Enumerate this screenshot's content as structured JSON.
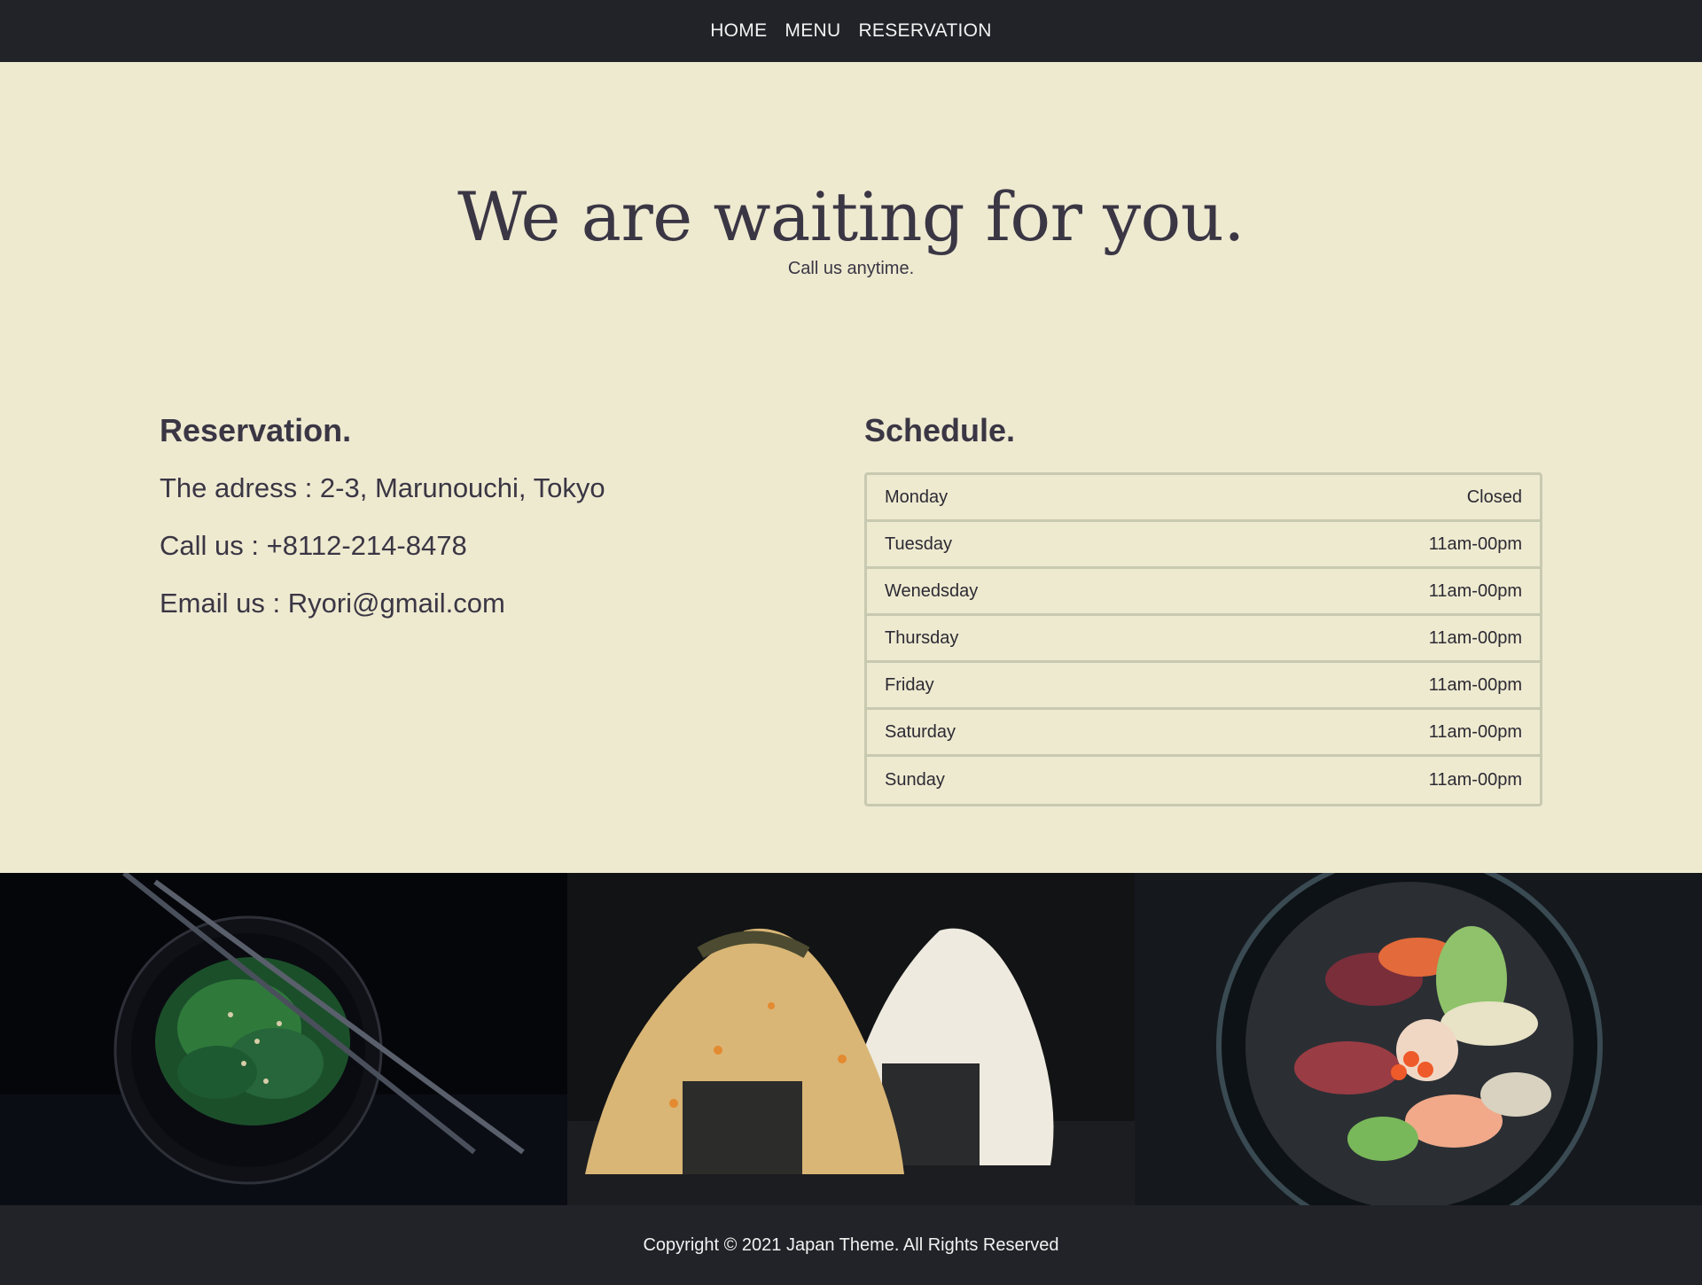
{
  "nav": {
    "items": [
      {
        "label": "HOME"
      },
      {
        "label": "MENU"
      },
      {
        "label": "RESERVATION"
      }
    ]
  },
  "hero": {
    "title": "We are waiting for you.",
    "subtitle": "Call us anytime."
  },
  "reservation": {
    "heading": "Reservation.",
    "address": "The adress : 2-3, Marunouchi, Tokyo",
    "phone": "Call us : +8112-214-8478",
    "email": "Email us : Ryori@gmail.com"
  },
  "schedule": {
    "heading": "Schedule.",
    "rows": [
      {
        "day": "Monday",
        "hours": "Closed"
      },
      {
        "day": "Tuesday",
        "hours": "11am-00pm"
      },
      {
        "day": "Wenedsday",
        "hours": "11am-00pm"
      },
      {
        "day": "Thursday",
        "hours": "11am-00pm"
      },
      {
        "day": "Friday",
        "hours": "11am-00pm"
      },
      {
        "day": "Saturday",
        "hours": "11am-00pm"
      },
      {
        "day": "Sunday",
        "hours": "11am-00pm"
      }
    ]
  },
  "gallery": {
    "images": [
      {
        "name": "seaweed-salad-photo"
      },
      {
        "name": "onigiri-photo"
      },
      {
        "name": "sashimi-bowl-photo"
      }
    ]
  },
  "footer": {
    "copyright": "Copyright © 2021 Japan Theme. All Rights Reserved"
  },
  "colors": {
    "nav_bg": "#212328",
    "page_bg": "#eeead0",
    "text": "#3a3644",
    "table_border": "#c8c9b1"
  }
}
